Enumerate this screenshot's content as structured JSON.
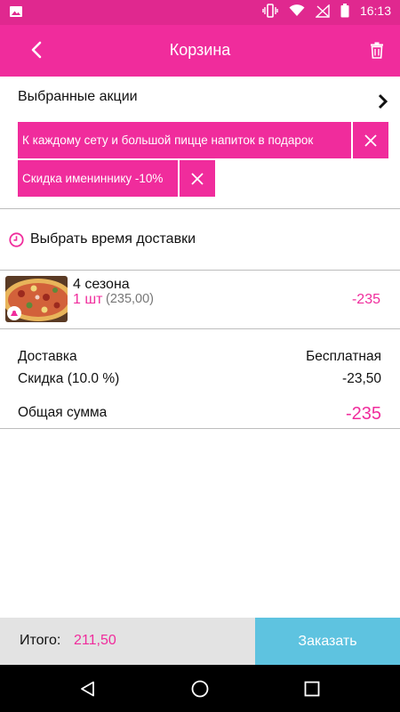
{
  "status_bar": {
    "time": "16:13",
    "icons": [
      "image-icon",
      "vibrate-icon",
      "wifi-icon",
      "signal-icon",
      "battery-icon"
    ]
  },
  "app_bar": {
    "title": "Корзина",
    "back_icon": "arrow-back-icon",
    "delete_icon": "trash-icon"
  },
  "promos": {
    "header": "Выбранные акции",
    "items": [
      {
        "label": "К каждому сету и большой пицце напиток в подарок"
      },
      {
        "label": "Скидка имениннику -10%"
      }
    ]
  },
  "delivery_time": {
    "label": "Выбрать время доставки",
    "icon": "clock-icon"
  },
  "cart_items": [
    {
      "name": "4 сезона",
      "qty": "1 шт",
      "unit_price": "(235,00)",
      "total": "-235"
    }
  ],
  "summary": {
    "delivery_label": "Доставка",
    "delivery_value": "Бесплатная",
    "discount_label": "Скидка (10.0 %)",
    "discount_value": "-23,50",
    "total_label": "Общая сумма",
    "total_value": "-235"
  },
  "footer": {
    "total_label": "Итого:",
    "total_value": "211,50",
    "order_button": "Заказать"
  },
  "colors": {
    "accent": "#f02c9c",
    "status_bar": "#e0288f",
    "order_button": "#5ec3e0",
    "footer_bg": "#e3e3e3"
  }
}
